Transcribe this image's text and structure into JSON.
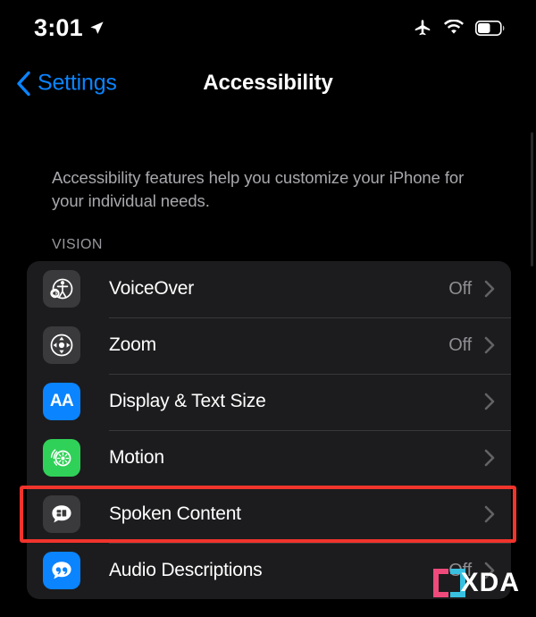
{
  "status_bar": {
    "time": "3:01",
    "location_icon": "location-arrow-icon",
    "airplane_icon": "airplane-mode-icon",
    "wifi_icon": "wifi-icon",
    "battery_icon": "battery-icon",
    "battery_level_percent": 52
  },
  "nav": {
    "back_label": "Settings",
    "back_icon": "chevron-left-icon",
    "title": "Accessibility"
  },
  "content": {
    "intro_text": "Accessibility features help you customize your iPhone for your individual needs.",
    "section_header": "VISION",
    "rows": [
      {
        "label": "VoiceOver",
        "value": "Off",
        "icon": "voiceover-icon",
        "icon_style": "gray"
      },
      {
        "label": "Zoom",
        "value": "Off",
        "icon": "zoom-icon",
        "icon_style": "gray"
      },
      {
        "label": "Display & Text Size",
        "value": "",
        "icon": "display-text-size-icon",
        "icon_style": "blue"
      },
      {
        "label": "Motion",
        "value": "",
        "icon": "motion-icon",
        "icon_style": "green"
      },
      {
        "label": "Spoken Content",
        "value": "",
        "icon": "spoken-content-icon",
        "icon_style": "gray"
      },
      {
        "label": "Audio Descriptions",
        "value": "Off",
        "icon": "audio-descriptions-icon",
        "icon_style": "blue"
      }
    ]
  },
  "annotation": {
    "target_row_label": "Spoken Content",
    "color": "#f0342c"
  },
  "watermark": {
    "text": "XDA",
    "bracket_left_color": "#ef4a7b",
    "bracket_right_color": "#37c0e0"
  },
  "colors": {
    "page_background": "#000000",
    "card_background": "#1c1c1e",
    "accent_blue": "#0a84ff",
    "secondary_text": "#8e8e93",
    "green": "#30d158"
  }
}
